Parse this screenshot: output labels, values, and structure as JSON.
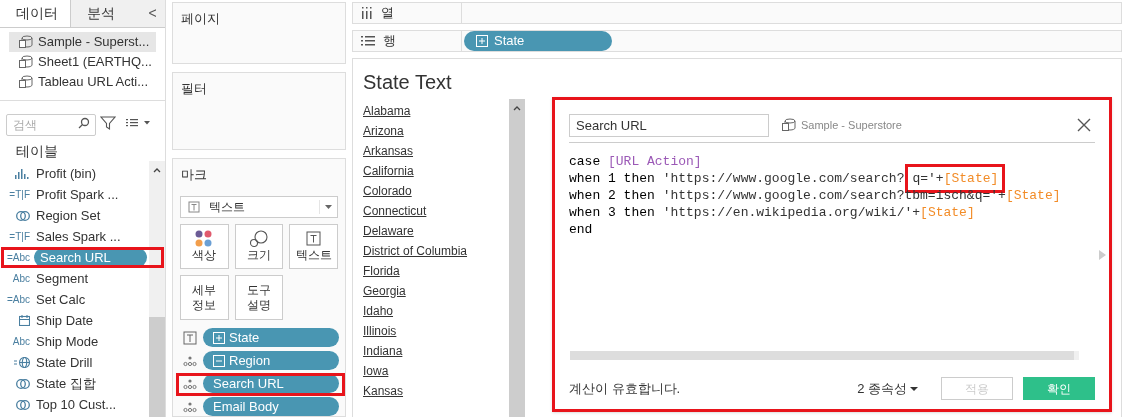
{
  "data_pane": {
    "tabs": [
      {
        "label": "데이터",
        "selected": true
      },
      {
        "label": "분석",
        "selected": false
      }
    ],
    "collapse": "<",
    "sources": [
      {
        "name": "Sample - Superst...",
        "selected": true
      },
      {
        "name": "Sheet1 (EARTHQ...",
        "selected": false
      },
      {
        "name": "Tableau URL Acti...",
        "selected": false
      }
    ],
    "search": {
      "placeholder": "검색"
    },
    "section": "테이블",
    "fields": [
      {
        "name": "Profit (bin)",
        "kind": "bin",
        "highlighted": false
      },
      {
        "name": "Profit Spark ...",
        "kind": "lettered",
        "icon": "=T|F",
        "highlighted": false
      },
      {
        "name": "Region Set",
        "kind": "set",
        "highlighted": false
      },
      {
        "name": "Sales Spark ...",
        "kind": "lettered",
        "icon": "=T|F",
        "highlighted": false
      },
      {
        "name": "Search URL",
        "kind": "lettered",
        "icon": "=Abc",
        "highlighted": true
      },
      {
        "name": "Segment",
        "kind": "lettered",
        "icon": "Abc",
        "highlighted": false
      },
      {
        "name": "Set Calc",
        "kind": "lettered",
        "icon": "=Abc",
        "highlighted": false
      },
      {
        "name": "Ship Date",
        "kind": "date",
        "highlighted": false
      },
      {
        "name": "Ship Mode",
        "kind": "lettered",
        "icon": "Abc",
        "highlighted": false
      },
      {
        "name": "State Drill",
        "kind": "calc_geo",
        "highlighted": false
      },
      {
        "name": "State 집합",
        "kind": "set",
        "highlighted": false
      },
      {
        "name": "Top 10 Cust...",
        "kind": "set",
        "highlighted": false
      }
    ]
  },
  "pages_card": {
    "title": "페이지"
  },
  "filters_card": {
    "title": "필터"
  },
  "marks_card": {
    "title": "마크",
    "mark_type": "텍스트",
    "buttons": [
      {
        "label": "색상",
        "kind": "color"
      },
      {
        "label": "크기",
        "kind": "size"
      },
      {
        "label": "텍스트",
        "kind": "text"
      },
      {
        "label": "세부\n정보",
        "kind": "detail"
      },
      {
        "label": "도구\n설명",
        "kind": "tooltip"
      }
    ],
    "pills": [
      {
        "name": "State",
        "kind": "text",
        "expanded": false,
        "highlighted": false
      },
      {
        "name": "Region",
        "kind": "detail",
        "expanded": true,
        "highlighted": false
      },
      {
        "name": "Search URL",
        "kind": "detail",
        "highlighted": true
      },
      {
        "name": "Email Body",
        "kind": "detail",
        "highlighted": false
      }
    ]
  },
  "columns_shelf": {
    "label": "열"
  },
  "rows_shelf": {
    "label": "행",
    "pills": [
      {
        "name": "State",
        "expanded": false
      }
    ]
  },
  "view": {
    "title": "State Text",
    "states": [
      "Alabama",
      "Arizona",
      "Arkansas",
      "California",
      "Colorado",
      "Connecticut",
      "Delaware",
      "District of Columbia",
      "Florida",
      "Georgia",
      "Idaho",
      "Illinois",
      "Indiana",
      "Iowa",
      "Kansas"
    ]
  },
  "calc_dialog": {
    "highlighted": true,
    "name": "Search URL",
    "source": "Sample - Superstore",
    "code": [
      [
        {
          "text": "case ",
          "kind": "keyword",
          "highlighted": false
        },
        {
          "text": "[URL Action]",
          "kind": "parameter",
          "highlighted": false
        }
      ],
      [
        {
          "text": "when 1 then ",
          "kind": "keyword",
          "highlighted": false
        },
        {
          "text": "'https://www.google.com/search?",
          "kind": "string",
          "highlighted": false
        },
        {
          "text": "q='+",
          "kind": "string",
          "highlighted": true
        },
        {
          "text": "[State]",
          "kind": "field",
          "highlighted": true
        }
      ],
      [
        {
          "text": "when 2 then ",
          "kind": "keyword",
          "highlighted": false
        },
        {
          "text": "'https://www.google.com/search?tbm=isch&q='+",
          "kind": "string",
          "highlighted": false
        },
        {
          "text": "[State]",
          "kind": "field",
          "highlighted": false
        }
      ],
      [
        {
          "text": "when 3 then ",
          "kind": "keyword",
          "highlighted": false
        },
        {
          "text": "'https://en.wikipedia.org/wiki/'+",
          "kind": "string",
          "highlighted": false
        },
        {
          "text": "[State]",
          "kind": "field",
          "highlighted": false
        }
      ],
      [
        {
          "text": "end",
          "kind": "keyword",
          "highlighted": false
        }
      ]
    ],
    "status": "계산이 유효합니다.",
    "dependencies": "2 종속성",
    "buttons": [
      {
        "label": "적용",
        "kind": "apply",
        "disabled": true
      },
      {
        "label": "확인",
        "kind": "ok",
        "disabled": false
      }
    ]
  }
}
